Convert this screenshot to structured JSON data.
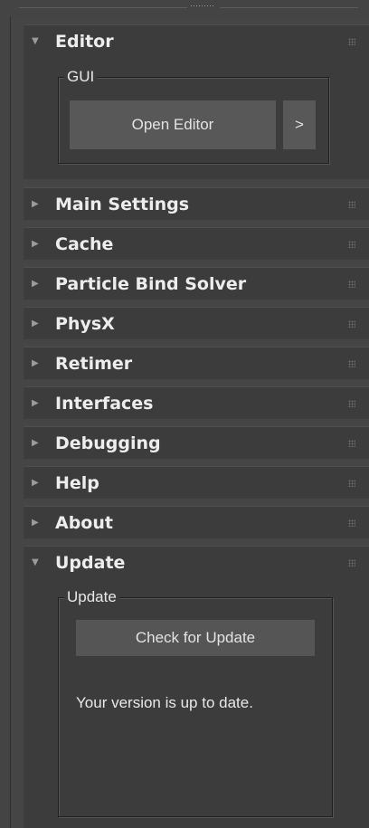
{
  "rollouts": [
    {
      "label": "Editor",
      "expanded": true
    },
    {
      "label": "Main Settings",
      "expanded": false
    },
    {
      "label": "Cache",
      "expanded": false
    },
    {
      "label": "Particle Bind Solver",
      "expanded": false
    },
    {
      "label": "PhysX",
      "expanded": false
    },
    {
      "label": "Retimer",
      "expanded": false
    },
    {
      "label": "Interfaces",
      "expanded": false
    },
    {
      "label": "Debugging",
      "expanded": false
    },
    {
      "label": "Help",
      "expanded": false
    },
    {
      "label": "About",
      "expanded": false
    },
    {
      "label": "Update",
      "expanded": true
    }
  ],
  "editor": {
    "group_title": "GUI",
    "open_editor_label": "Open Editor",
    "more_label": ">"
  },
  "update": {
    "group_title": "Update",
    "check_label": "Check for Update",
    "status": "Your version is up to date."
  },
  "icons": {
    "expanded": "triangle-down-icon",
    "collapsed": "triangle-right-icon",
    "drag_handle": "grip-dots-icon"
  },
  "colors": {
    "panel_bg": "#454545",
    "rollout_bg": "#3c3c3c",
    "button_bg": "#585858",
    "text": "#ededed"
  }
}
